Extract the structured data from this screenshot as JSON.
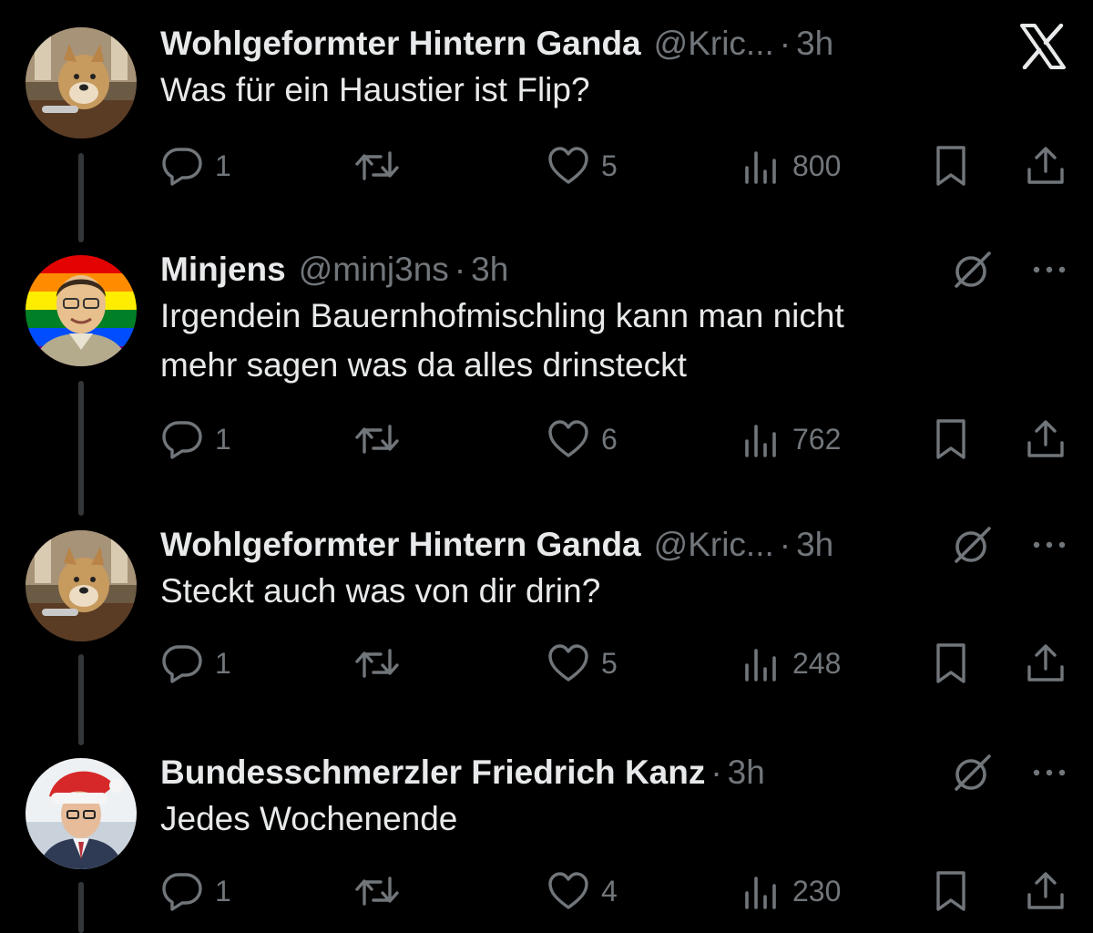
{
  "app": {
    "logo": "x-logo"
  },
  "tweets": [
    {
      "name": "Wohlgeformter Hintern Ganda",
      "handle": "@Kric...",
      "sep": "·",
      "time": "3h",
      "text": "Was für ein Haustier ist Flip?",
      "avatar": "dog-avatar",
      "stats": {
        "replies": "1",
        "likes": "5",
        "views": "800"
      }
    },
    {
      "name": "Minjens",
      "handle": "@minj3ns",
      "sep": "·",
      "time": "3h",
      "text": "Irgendein Bauernhofmischling kann man nicht\nmehr sagen was da alles drinsteckt",
      "avatar": "rainbow-man-avatar",
      "stats": {
        "replies": "1",
        "likes": "6",
        "views": "762"
      }
    },
    {
      "name": "Wohlgeformter Hintern Ganda",
      "handle": "@Kric...",
      "sep": "·",
      "time": "3h",
      "text": "Steckt auch was von dir drin?",
      "avatar": "dog-avatar",
      "stats": {
        "replies": "1",
        "likes": "5",
        "views": "248"
      }
    },
    {
      "name": "Bundesschmerzler Friedrich Kanz",
      "handle": "",
      "sep": "·",
      "time": "3h",
      "text": "Jedes Wochenende",
      "avatar": "santa-hat-man-avatar",
      "stats": {
        "replies": "1",
        "likes": "4",
        "views": "230"
      }
    }
  ],
  "colors": {
    "background": "#000000",
    "text": "#e7e9ea",
    "muted": "#71767b",
    "thread": "#333639"
  },
  "icons": [
    "reply-icon",
    "retweet-icon",
    "like-icon",
    "views-icon",
    "bookmark-icon",
    "share-icon",
    "grok-icon",
    "more-icon",
    "x-logo"
  ]
}
